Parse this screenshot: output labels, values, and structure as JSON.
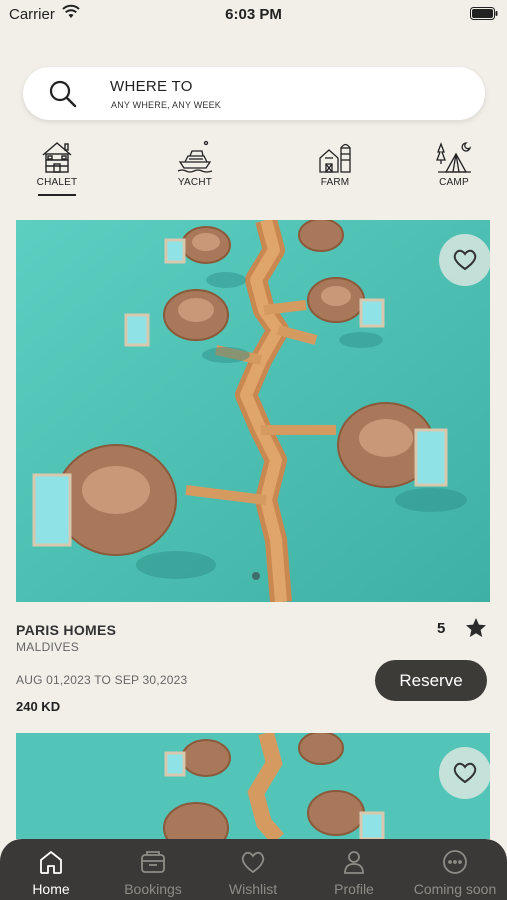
{
  "status_bar": {
    "carrier": "Carrier",
    "time": "6:03 PM"
  },
  "search": {
    "title": "WHERE TO",
    "subtitle": "ANY WHERE, ANY WEEK"
  },
  "categories": [
    {
      "label": "CHALET",
      "icon": "chalet-icon",
      "active": true
    },
    {
      "label": "YACHT",
      "icon": "yacht-icon",
      "active": false
    },
    {
      "label": "FARM",
      "icon": "farm-icon",
      "active": false
    },
    {
      "label": "CAMP",
      "icon": "camp-icon",
      "active": false
    }
  ],
  "listings": [
    {
      "name": "PARIS HOMES",
      "location": "MALDIVES",
      "dates": "AUG 01,2023 TO SEP 30,2023",
      "price": "240 KD",
      "rating": "5",
      "reserve_label": "Reserve"
    }
  ],
  "tabs": [
    {
      "label": "Home",
      "icon": "home-icon",
      "active": true
    },
    {
      "label": "Bookings",
      "icon": "bookings-icon",
      "active": false
    },
    {
      "label": "Wishlist",
      "icon": "heart-icon",
      "active": false
    },
    {
      "label": "Profile",
      "icon": "profile-icon",
      "active": false
    },
    {
      "label": "Coming soon",
      "icon": "more-icon",
      "active": false
    }
  ],
  "colors": {
    "background": "#f2efe9",
    "lagoon": "#4fc1b4",
    "tabbar": "#3b3937",
    "button": "#3d3b38"
  }
}
